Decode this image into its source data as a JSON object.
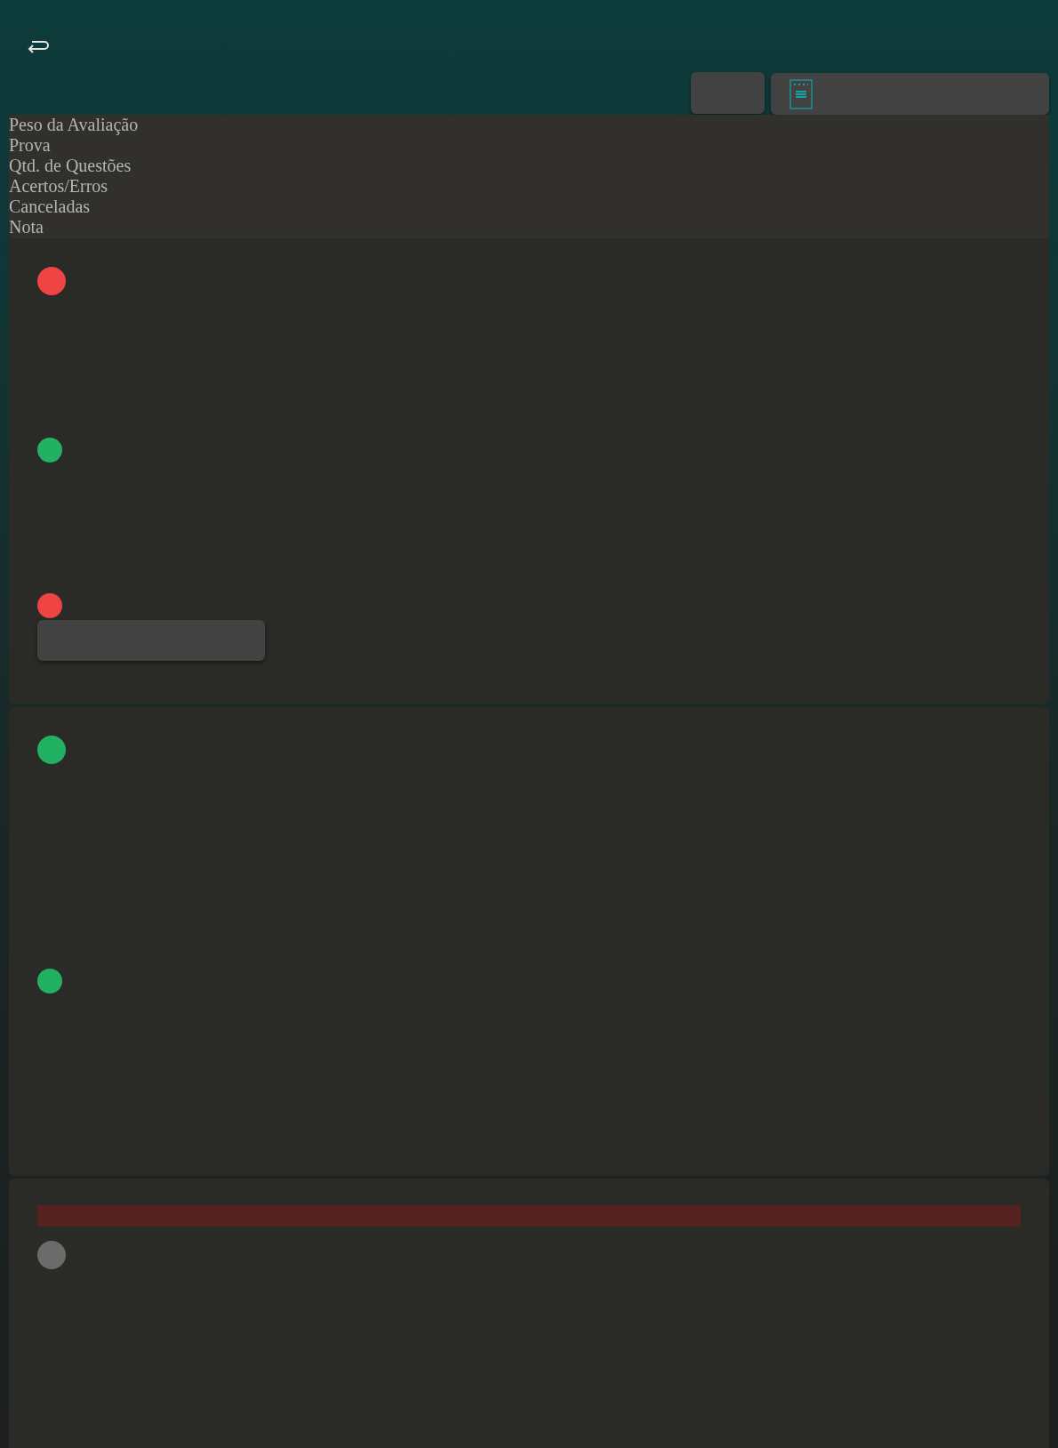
{
  "header": {
    "labels": [
      "Peso da Avaliação",
      "Prova",
      "Qtd. de Questões",
      "Acertos/Erros",
      "Canceladas",
      "Nota"
    ]
  },
  "cards": [
    {
      "items": [
        {
          "kind": "dot",
          "color": "#ef4444"
        },
        {
          "kind": "dot",
          "color": "#22b062"
        },
        {
          "kind": "dot",
          "color": "#ef4444"
        },
        {
          "kind": "button"
        }
      ]
    },
    {
      "items": [
        {
          "kind": "dot",
          "color": "#22b062"
        },
        {
          "kind": "dot",
          "color": "#22b062"
        }
      ]
    },
    {
      "items": [
        {
          "kind": "bar"
        },
        {
          "kind": "dot",
          "color": "#6b6b6b"
        }
      ]
    }
  ]
}
